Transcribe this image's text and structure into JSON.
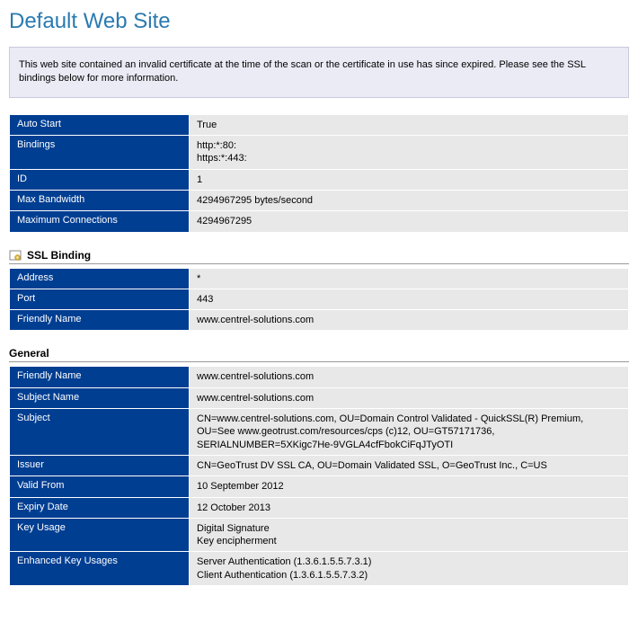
{
  "page": {
    "title": "Default Web Site",
    "notice": "This web site contained an invalid certificate at the time of the scan or the certificate in use has since expired.  Please see the SSL bindings below for more information."
  },
  "site_props": {
    "auto_start_label": "Auto Start",
    "auto_start_value": "True",
    "bindings_label": "Bindings",
    "bindings_value": "http:*:80:\nhttps:*:443:",
    "id_label": "ID",
    "id_value": "1",
    "max_bw_label": "Max Bandwidth",
    "max_bw_value": "4294967295 bytes/second",
    "max_conn_label": "Maximum Connections",
    "max_conn_value": "4294967295"
  },
  "ssl_section": {
    "header": "SSL Binding",
    "address_label": "Address",
    "address_value": "*",
    "port_label": "Port",
    "port_value": "443",
    "friendly_label": "Friendly Name",
    "friendly_value": "www.centrel-solutions.com"
  },
  "general_section": {
    "header": "General",
    "friendly_label": "Friendly Name",
    "friendly_value": "www.centrel-solutions.com",
    "subject_name_label": "Subject Name",
    "subject_name_value": "www.centrel-solutions.com",
    "subject_label": "Subject",
    "subject_value": "CN=www.centrel-solutions.com, OU=Domain Control Validated - QuickSSL(R) Premium, OU=See www.geotrust.com/resources/cps (c)12, OU=GT57171736, SERIALNUMBER=5XKigc7He-9VGLA4cfFbokCiFqJTyOTI",
    "issuer_label": "Issuer",
    "issuer_value": "CN=GeoTrust DV SSL CA, OU=Domain Validated SSL, O=GeoTrust Inc., C=US",
    "valid_from_label": "Valid From",
    "valid_from_value": "10 September 2012",
    "expiry_label": "Expiry Date",
    "expiry_value": "12 October 2013",
    "key_usage_label": "Key Usage",
    "key_usage_value": "Digital Signature\nKey encipherment",
    "eku_label": "Enhanced Key Usages",
    "eku_value": "Server Authentication (1.3.6.1.5.5.7.3.1)\nClient Authentication (1.3.6.1.5.5.7.3.2)"
  }
}
